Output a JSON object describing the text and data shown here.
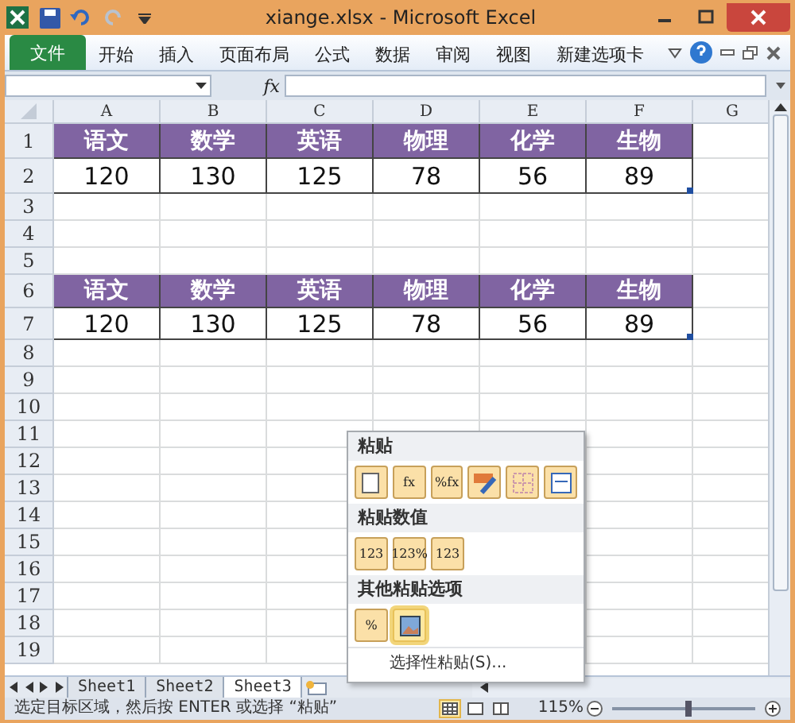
{
  "window": {
    "title": "xiange.xlsx - Microsoft Excel"
  },
  "ribbon_tabs": [
    {
      "label": "文件",
      "kind": "file"
    },
    {
      "label": "开始",
      "kind": "tab"
    },
    {
      "label": "插入",
      "kind": "tab"
    },
    {
      "label": "页面布局",
      "kind": "tab"
    },
    {
      "label": "公式",
      "kind": "tab"
    },
    {
      "label": "数据",
      "kind": "tab"
    },
    {
      "label": "审阅",
      "kind": "tab"
    },
    {
      "label": "视图",
      "kind": "tab"
    },
    {
      "label": "新建选项卡",
      "kind": "tab"
    }
  ],
  "formula_bar": {
    "fx": "fx"
  },
  "columns": [
    "A",
    "B",
    "C",
    "D",
    "E",
    "F",
    "G"
  ],
  "rows": [
    {
      "number": "1",
      "kind": "header",
      "cells": [
        "语文",
        "数学",
        "英语",
        "物理",
        "化学",
        "生物"
      ]
    },
    {
      "number": "2",
      "kind": "value",
      "cells": [
        "120",
        "130",
        "125",
        "78",
        "56",
        "89"
      ]
    },
    {
      "number": "3",
      "kind": "empty",
      "cells": []
    },
    {
      "number": "4",
      "kind": "empty",
      "cells": []
    },
    {
      "number": "5",
      "kind": "empty",
      "cells": []
    },
    {
      "number": "6",
      "kind": "header",
      "cells": [
        "语文",
        "数学",
        "英语",
        "物理",
        "化学",
        "生物"
      ]
    },
    {
      "number": "7",
      "kind": "value",
      "cells": [
        "120",
        "130",
        "125",
        "78",
        "56",
        "89"
      ]
    },
    {
      "number": "8",
      "kind": "empty",
      "cells": []
    },
    {
      "number": "9",
      "kind": "empty",
      "cells": []
    },
    {
      "number": "10",
      "kind": "empty",
      "cells": []
    },
    {
      "number": "11",
      "kind": "empty",
      "cells": []
    },
    {
      "number": "12",
      "kind": "empty",
      "cells": []
    },
    {
      "number": "13",
      "kind": "empty",
      "cells": []
    },
    {
      "number": "14",
      "kind": "empty",
      "cells": []
    },
    {
      "number": "15",
      "kind": "empty",
      "cells": []
    },
    {
      "number": "16",
      "kind": "empty",
      "cells": []
    },
    {
      "number": "17",
      "kind": "empty",
      "cells": []
    },
    {
      "number": "18",
      "kind": "empty",
      "cells": []
    },
    {
      "number": "19",
      "kind": "empty",
      "cells": []
    }
  ],
  "paste_menu": {
    "sections": [
      {
        "title": "粘贴",
        "options": [
          {
            "kind": "page",
            "selected": false
          },
          {
            "kind": "glyph",
            "glyph": "fx",
            "selected": false
          },
          {
            "kind": "glyph",
            "glyph": "%fx",
            "selected": false
          },
          {
            "kind": "brush",
            "selected": false
          },
          {
            "kind": "grid",
            "selected": false
          },
          {
            "kind": "widths",
            "selected": false
          }
        ]
      },
      {
        "title": "粘贴数值",
        "options": [
          {
            "kind": "glyph",
            "glyph": "123",
            "selected": false
          },
          {
            "kind": "glyph",
            "glyph": "123%",
            "selected": false
          },
          {
            "kind": "glyph",
            "glyph": "123",
            "selected": false
          }
        ]
      },
      {
        "title": "其他粘贴选项",
        "options": [
          {
            "kind": "glyph",
            "glyph": "%",
            "selected": false
          },
          {
            "kind": "picture",
            "selected": true
          }
        ]
      }
    ],
    "special": "选择性粘贴(S)..."
  },
  "sheet_tabs": [
    {
      "label": "Sheet1",
      "selected": false
    },
    {
      "label": "Sheet2",
      "selected": false
    },
    {
      "label": "Sheet3",
      "selected": true
    }
  ],
  "status_bar": {
    "message": "选定目标区域，然后按 ENTER 或选择 “粘贴”",
    "views": [
      {
        "kind": "normal",
        "selected": true
      },
      {
        "kind": "layout",
        "selected": false
      },
      {
        "kind": "break",
        "selected": false
      }
    ],
    "zoom": "115%",
    "zoom_slider": {
      "level": 0.53
    }
  }
}
